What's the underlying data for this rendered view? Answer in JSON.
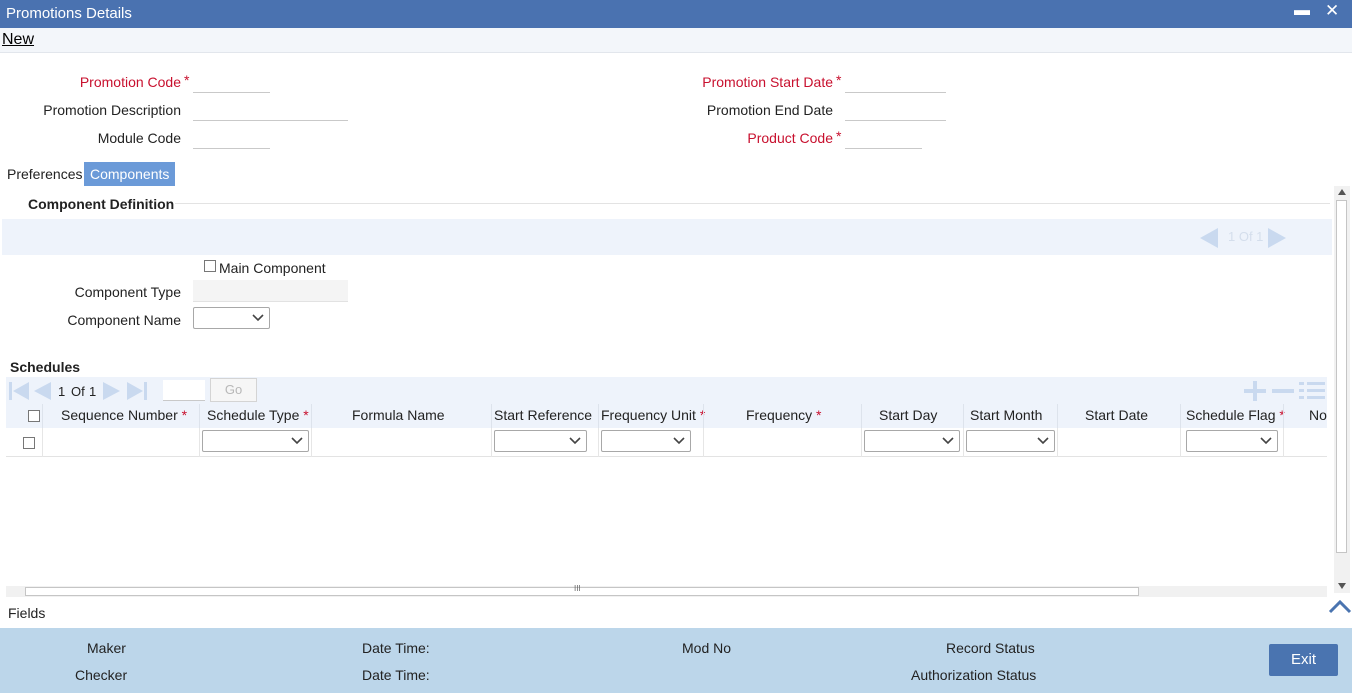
{
  "window": {
    "title": "Promotions Details",
    "minimize_glyph": "▬",
    "close_glyph": "✕"
  },
  "menu": {
    "new_label": "New"
  },
  "header_fields": {
    "promotion_code": {
      "label": "Promotion Code",
      "required": "*",
      "value": ""
    },
    "promotion_description": {
      "label": "Promotion Description",
      "value": ""
    },
    "module_code": {
      "label": "Module Code",
      "value": ""
    },
    "promotion_start_date": {
      "label": "Promotion Start Date",
      "required": "*",
      "value": ""
    },
    "promotion_end_date": {
      "label": "Promotion End Date",
      "value": ""
    },
    "product_code": {
      "label": "Product Code",
      "required": "*",
      "value": ""
    }
  },
  "tabs": [
    {
      "label": "Preferences",
      "active": false
    },
    {
      "label": "Components",
      "active": true
    }
  ],
  "component_definition": {
    "title": "Component Definition",
    "pager_text": "1 Of 1",
    "main_component_label": "Main Component",
    "component_type_label": "Component Type",
    "component_name_label": "Component Name",
    "component_name_value": ""
  },
  "schedules": {
    "title": "Schedules",
    "pager": {
      "page": "1",
      "of_label": "Of",
      "total": "1",
      "go_label": "Go"
    },
    "columns": [
      {
        "label": "Sequence Number",
        "required": "*"
      },
      {
        "label": "Schedule Type",
        "required": "*"
      },
      {
        "label": "Formula Name",
        "required": ""
      },
      {
        "label": "Start Reference",
        "required": ""
      },
      {
        "label": "Frequency Unit",
        "required": "*"
      },
      {
        "label": "Frequency",
        "required": "*"
      },
      {
        "label": "Start Day",
        "required": ""
      },
      {
        "label": "Start Month",
        "required": ""
      },
      {
        "label": "Start Date",
        "required": ""
      },
      {
        "label": "Schedule Flag",
        "required": "*"
      },
      {
        "label": "No",
        "required": ""
      }
    ],
    "scrollbar_grip": "III"
  },
  "fields_link": "Fields",
  "footer": {
    "maker_label": "Maker",
    "checker_label": "Checker",
    "date_time_label_1": "Date Time:",
    "date_time_label_2": "Date Time:",
    "mod_no_label": "Mod No",
    "record_status_label": "Record Status",
    "authorization_status_label": "Authorization Status",
    "exit_label": "Exit"
  },
  "colors": {
    "titlebar": "#4a72b0",
    "active_tab": "#6b9ad8",
    "required": "#c8102e",
    "footer": "#bcd6ea",
    "exit_button": "#4a74b0"
  },
  "icons": [
    "minimize-icon",
    "close-icon",
    "first-page-icon",
    "prev-page-icon",
    "next-page-icon",
    "last-page-icon",
    "add-row-icon",
    "delete-row-icon",
    "single-view-icon",
    "chevron-down-icon",
    "collapse-up-icon"
  ]
}
